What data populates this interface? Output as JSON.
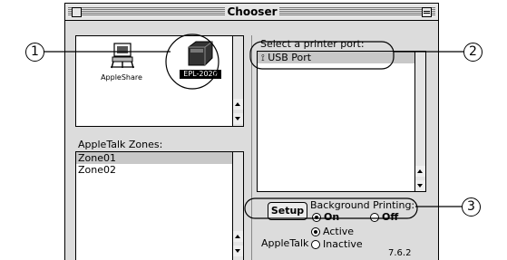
{
  "window": {
    "title": "Chooser",
    "version": "7.6.2"
  },
  "device_pane": {
    "items": [
      {
        "label": "AppleShare",
        "icon": "appleshare-icon"
      },
      {
        "label": "EPL-2020",
        "icon": "printer-icon"
      }
    ]
  },
  "zones": {
    "label": "AppleTalk Zones:",
    "items": [
      "Zone01",
      "Zone02"
    ]
  },
  "port": {
    "label": "Select a printer port:",
    "items": [
      {
        "label": "USB Port",
        "icon": "usb-icon"
      }
    ]
  },
  "setup_button": "Setup",
  "background_printing": {
    "label": "Background Printing:",
    "on": "On",
    "off": "Off",
    "selected": "On"
  },
  "appletalk": {
    "label": "AppleTalk",
    "active": "Active",
    "inactive": "Inactive",
    "selected": "Active"
  },
  "callouts": [
    "1",
    "2",
    "3"
  ],
  "colors": {
    "window_bg": "#dcdcdc",
    "selection": "#c8c8c8"
  }
}
